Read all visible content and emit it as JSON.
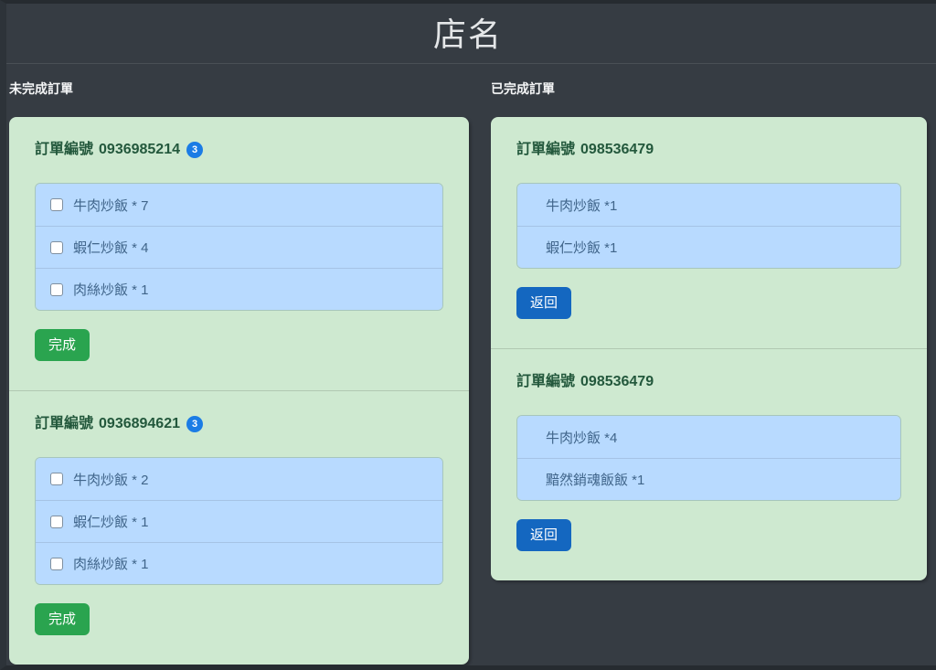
{
  "header": {
    "title": "店名"
  },
  "pending": {
    "label": "未完成訂單",
    "action_label": "完成",
    "orders": [
      {
        "title_label": "訂單編號",
        "number": "0936985214",
        "badge": "3",
        "items": [
          "牛肉炒飯 * 7",
          "蝦仁炒飯 * 4",
          "肉絲炒飯 * 1"
        ]
      },
      {
        "title_label": "訂單編號",
        "number": "0936894621",
        "badge": "3",
        "items": [
          "牛肉炒飯 * 2",
          "蝦仁炒飯 * 1",
          "肉絲炒飯 * 1"
        ]
      }
    ]
  },
  "completed": {
    "label": "已完成訂單",
    "action_label": "返回",
    "orders": [
      {
        "title_label": "訂單編號",
        "number": "098536479",
        "items": [
          "牛肉炒飯 *1",
          "蝦仁炒飯 *1"
        ]
      },
      {
        "title_label": "訂單編號",
        "number": "098536479",
        "items": [
          "牛肉炒飯 *4",
          "黯然銷魂飯飯 *1"
        ]
      }
    ]
  },
  "colors": {
    "page_bg": "#363c43",
    "panel_bg": "#cee9d0",
    "item_bg": "#b8daff",
    "item_text": "#40658a",
    "heading_text": "#23583c",
    "complete_button": "#2aa44f",
    "return_button": "#1467c0",
    "badge": "#1b7ce5"
  }
}
